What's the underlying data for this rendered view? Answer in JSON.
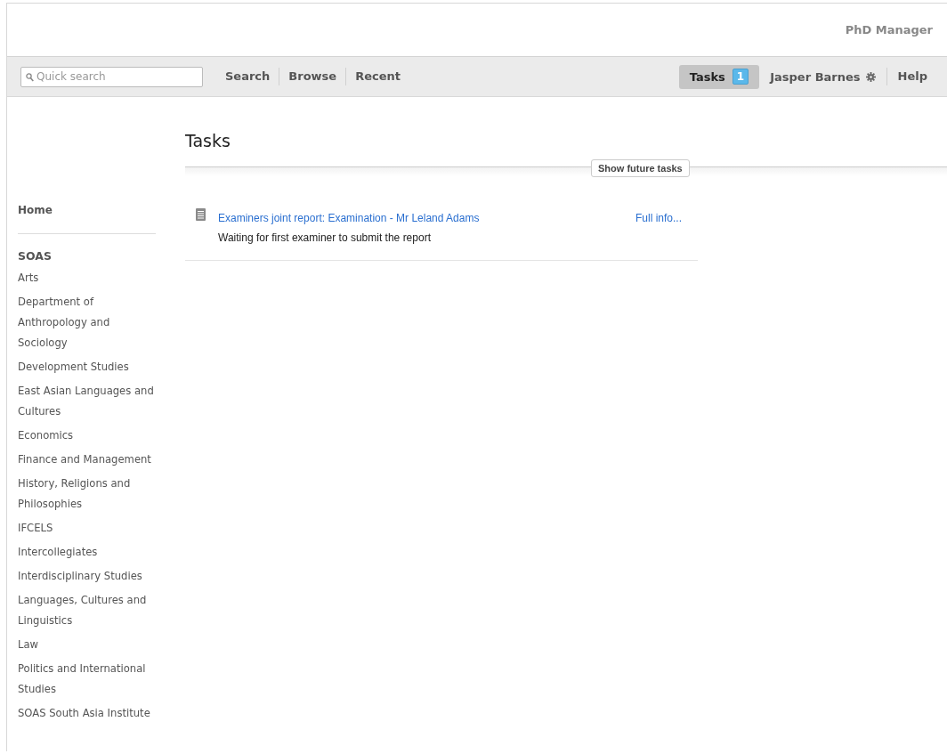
{
  "header": {
    "app_name": "PhD Manager"
  },
  "nav": {
    "search": {
      "placeholder": "Quick search"
    },
    "links": [
      {
        "label": "Search"
      },
      {
        "label": "Browse"
      },
      {
        "label": "Recent"
      }
    ],
    "tasks": {
      "label": "Tasks",
      "count": "1",
      "selected": true
    },
    "user": {
      "name": "Jasper Barnes"
    },
    "help": {
      "label": "Help"
    }
  },
  "sidebar": {
    "home": "Home",
    "section": "SOAS",
    "items": [
      "Arts",
      "Department of Anthropology and Sociology",
      "Development Studies",
      "East Asian Languages and Cultures",
      "Economics",
      "Finance and Management",
      "History, Religions and Philosophies",
      "IFCELS",
      "Intercollegiates",
      "Interdisciplinary Studies",
      "Languages, Cultures and Linguistics",
      "Law",
      "Politics and International Studies",
      "SOAS South Asia Institute"
    ]
  },
  "main": {
    "title": "Tasks",
    "future_button": "Show future tasks",
    "tasks": [
      {
        "title": "Examiners joint report: Examination - Mr Leland Adams",
        "status": "Waiting for first examiner to submit the report",
        "link": "Full info..."
      }
    ]
  }
}
